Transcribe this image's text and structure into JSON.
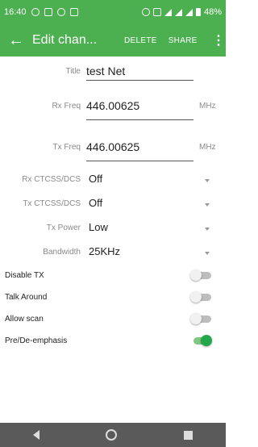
{
  "status_bar": {
    "time": "16:40",
    "battery": "48%",
    "left_icons": [
      "notification-icon",
      "image-icon",
      "notification-icon",
      "message-icon"
    ],
    "right_icons": [
      "alarm-icon",
      "nfc-icon",
      "wifi-icon",
      "signal-icon",
      "signal-icon",
      "battery-icon"
    ]
  },
  "app_bar": {
    "back_icon": "arrow-back-icon",
    "title": "Edit chan...",
    "delete_label": "DELETE",
    "share_label": "SHARE",
    "overflow_icon": "more-vert-icon",
    "color": "#4caf50"
  },
  "form": {
    "title": {
      "label": "Title",
      "value": "test Net"
    },
    "rx_freq": {
      "label": "Rx Freq",
      "value": "446.00625",
      "unit": "MHz"
    },
    "tx_freq": {
      "label": "Tx Freq",
      "value": "446.00625",
      "unit": "MHz"
    },
    "rx_ctcss": {
      "label": "Rx CTCSS/DCS",
      "value": "Off"
    },
    "tx_ctcss": {
      "label": "Tx CTCSS/DCS",
      "value": "Off"
    },
    "tx_power": {
      "label": "Tx Power",
      "value": "Low"
    },
    "bandwidth": {
      "label": "Bandwidth",
      "value": "25KHz"
    }
  },
  "switches": {
    "disable_tx": {
      "label": "Disable TX",
      "on": false
    },
    "talk_around": {
      "label": "Talk Around",
      "on": false
    },
    "allow_scan": {
      "label": "Allow scan",
      "on": false
    },
    "pre_deemphasis": {
      "label": "Pre/De-emphasis",
      "on": true
    },
    "on_color": "#22a84a"
  },
  "nav_bar": {
    "icons": [
      "nav-back-icon",
      "nav-home-icon",
      "nav-recents-icon"
    ]
  }
}
